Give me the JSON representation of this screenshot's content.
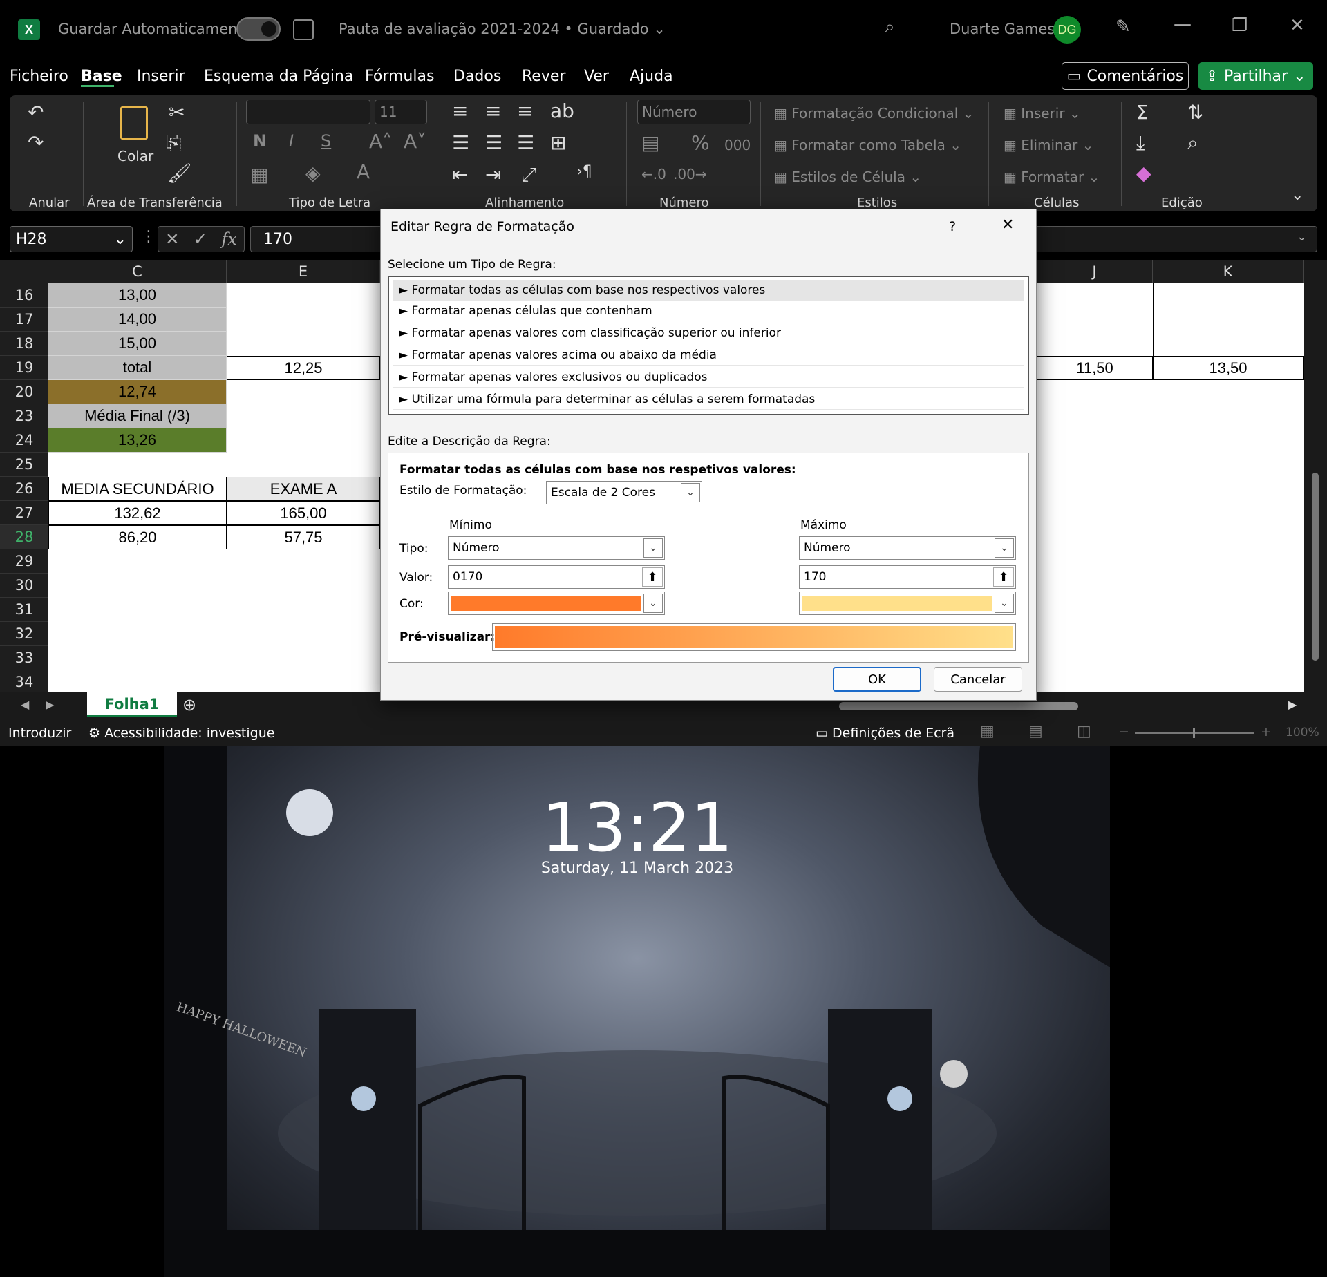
{
  "titlebar": {
    "logo": "X",
    "autosave_label": "Guardar Automaticamente",
    "doc_title": "Pauta de avaliação 2021-2024 • Guardado",
    "user_name": "Duarte Games",
    "user_initials": "DG"
  },
  "menu": {
    "items": [
      "Ficheiro",
      "Base",
      "Inserir",
      "Esquema da Página",
      "Fórmulas",
      "Dados",
      "Rever",
      "Ver",
      "Ajuda"
    ],
    "comments": "Comentários",
    "share": "Partilhar"
  },
  "ribbon": {
    "groups": [
      "Anular",
      "Área de Transferência",
      "Tipo de Letra",
      "Alinhamento",
      "Número",
      "Estilos",
      "Células",
      "Edição"
    ],
    "paste": "Colar",
    "font_size": "11",
    "number_format": "Número",
    "styles": [
      "Formatação Condicional",
      "Formatar como Tabela",
      "Estilos de Célula"
    ],
    "cells": [
      "Inserir",
      "Eliminar",
      "Formatar"
    ],
    "bold": "N",
    "italic": "I",
    "underline": "S",
    "percent": "%",
    "thousands": "000"
  },
  "formula_bar": {
    "name_box": "H28",
    "fx": "fx",
    "value": "170"
  },
  "grid": {
    "columns": [
      "C",
      "E",
      "J",
      "K"
    ],
    "rows": [
      "16",
      "17",
      "18",
      "19",
      "20",
      "23",
      "24",
      "25",
      "26",
      "27",
      "28",
      "29",
      "30",
      "31",
      "32",
      "33",
      "34"
    ],
    "colC": [
      "13,00",
      "14,00",
      "15,00",
      "total",
      "12,74",
      "Média Final (/3)",
      "13,26",
      "",
      "MEDIA SECUNDÁRIO",
      "132,62",
      "86,20"
    ],
    "colE": [
      "",
      "",
      "",
      "12,25",
      "",
      "",
      "",
      "",
      "EXAME A",
      "165,00",
      "57,75"
    ],
    "colJ19": "11,50",
    "colK19": "13,50",
    "colors": {
      "gray": "#bdbdbd",
      "olive": "#8b6f2a",
      "green": "#5a7d2a"
    }
  },
  "sheet": {
    "tab": "Folha1"
  },
  "status": {
    "mode": "Introduzir",
    "accessibility": "Acessibilidade: investigue",
    "display": "Definições de Ecrã",
    "zoom": "100%"
  },
  "dialog": {
    "title": "Editar Regra de Formatação",
    "help": "?",
    "select_label": "Selecione um Tipo de Regra:",
    "rules": [
      "Formatar todas as células com base nos respectivos valores",
      "Formatar apenas células que contenham",
      "Formatar apenas valores com classificação superior ou inferior",
      "Formatar apenas valores acima ou abaixo da média",
      "Formatar apenas valores exclusivos ou duplicados",
      "Utilizar uma fórmula para determinar as células a serem formatadas"
    ],
    "edit_label": "Edite a Descrição da Regra:",
    "desc_heading": "Formatar todas as células com base nos respetivos valores:",
    "style_label": "Estilo de Formatação:",
    "style_value": "Escala de 2 Cores",
    "min_label": "Mínimo",
    "max_label": "Máximo",
    "type_label": "Tipo:",
    "value_label": "Valor:",
    "color_label": "Cor:",
    "min_type": "Número",
    "max_type": "Número",
    "min_value": "0170",
    "max_value": "170",
    "min_color": "#ff7a2a",
    "max_color": "#ffe08a",
    "preview_label": "Pré-visualizar:",
    "ok": "OK",
    "cancel": "Cancelar"
  },
  "lockscreen": {
    "time": "13:21",
    "date": "Saturday, 11 March 2023",
    "sign": "HAPPY HALLOWEEN"
  }
}
